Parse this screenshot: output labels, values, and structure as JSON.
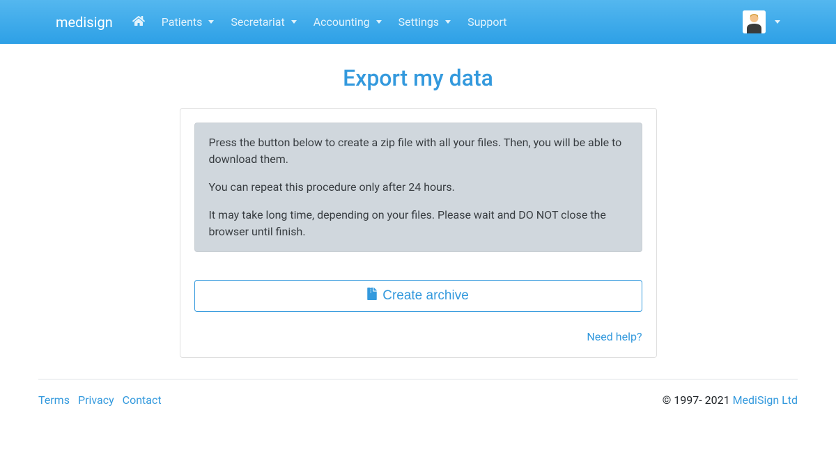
{
  "navbar": {
    "brand": "medisign",
    "items": [
      {
        "label": "Patients",
        "hasDropdown": true
      },
      {
        "label": "Secretariat",
        "hasDropdown": true
      },
      {
        "label": "Accounting",
        "hasDropdown": true
      },
      {
        "label": "Settings",
        "hasDropdown": true
      },
      {
        "label": "Support",
        "hasDropdown": false
      }
    ]
  },
  "page": {
    "title": "Export my data"
  },
  "alert": {
    "p1": "Press the button below to create a zip file with all your files. Then, you will be able to download them.",
    "p2": "You can repeat this procedure only after 24 hours.",
    "p3": "It may take long time, depending on your files. Please wait and DO NOT close the browser until finish."
  },
  "button": {
    "create_archive": "Create archive"
  },
  "links": {
    "need_help": "Need help?"
  },
  "footer": {
    "terms": "Terms",
    "privacy": "Privacy",
    "contact": "Contact",
    "copyright_prefix": "© 1997- 2021 ",
    "company": "MediSign Ltd"
  }
}
